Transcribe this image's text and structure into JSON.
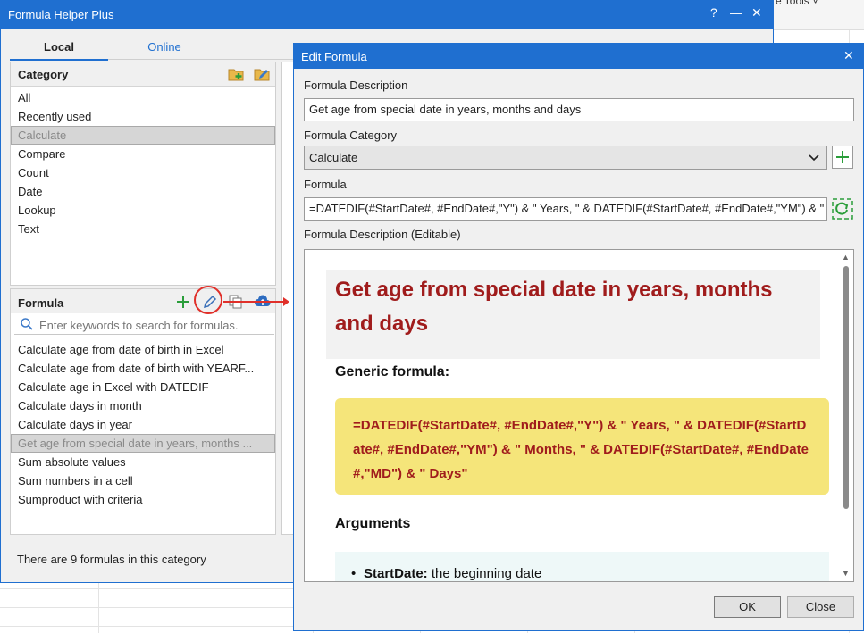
{
  "background": {
    "ribbon_text": "e Tools ˅"
  },
  "main_dialog": {
    "title": "Formula Helper Plus",
    "help_label": "?",
    "minimize_label": "—",
    "close_label": "✕",
    "tabs": {
      "local": "Local",
      "online": "Online"
    },
    "category": {
      "heading": "Category",
      "items": [
        "All",
        "Recently used",
        "Calculate",
        "Compare",
        "Count",
        "Date",
        "Lookup",
        "Text"
      ],
      "selected_index": 2
    },
    "formula": {
      "heading": "Formula",
      "search_placeholder": "Enter keywords to search for formulas.",
      "items": [
        "Calculate age from date of birth in Excel",
        "Calculate age from date of birth with YEARF...",
        "Calculate age in Excel with DATEDIF",
        "Calculate days in month",
        "Calculate days in year",
        "Get age from special date in years, months ...",
        "Sum absolute values",
        "Sum numbers in a cell",
        "Sumproduct with criteria"
      ],
      "selected_index": 5
    },
    "status": "There are 9 formulas in this category"
  },
  "edit_dialog": {
    "title": "Edit Formula",
    "close_label": "✕",
    "description_label": "Formula Description",
    "description_value": "Get age from special date in years, months and days",
    "category_label": "Formula Category",
    "category_value": "Calculate",
    "formula_label": "Formula",
    "formula_value": "=DATEDIF(#StartDate#, #EndDate#,\"Y\") & \" Years, \" & DATEDIF(#StartDate#, #EndDate#,\"YM\") & \"",
    "editable_label": "Formula Description (Editable)",
    "preview": {
      "title": "Get age from special date in years, months and days",
      "generic_heading": "Generic formula:",
      "code": "=DATEDIF(#StartDate#, #EndDate#,\"Y\") & \" Years, \" & DATEDIF(#StartDate#, #EndDate#,\"YM\") & \" Months, \" & DATEDIF(#StartDate#, #EndDate#,\"MD\") & \" Days\"",
      "arguments_heading": "Arguments",
      "arg1_name": "StartDate:",
      "arg1_desc": " the beginning date"
    },
    "ok_label": "OK",
    "close_button_label": "Close"
  },
  "colors": {
    "accent": "#1f6fd0",
    "title_red": "#a01c1c",
    "code_bg": "#f5e57a",
    "highlight": "#e0302a"
  }
}
